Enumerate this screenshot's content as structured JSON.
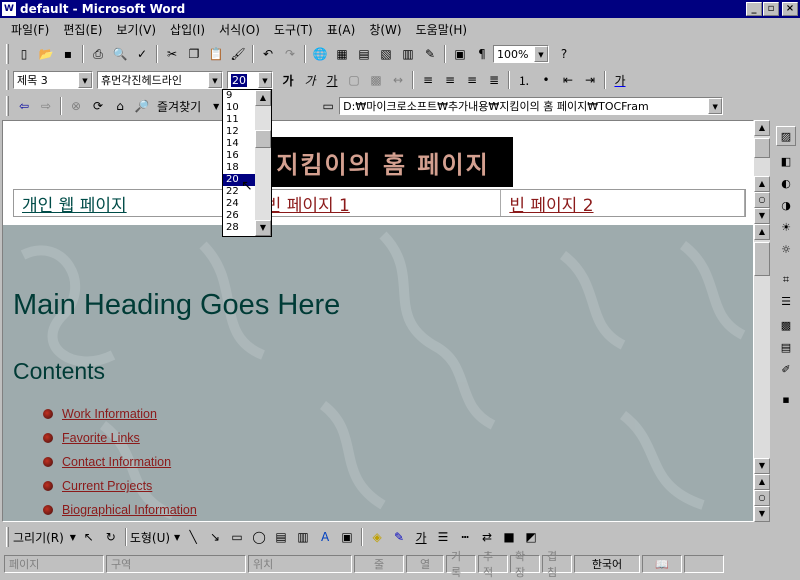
{
  "window": {
    "title": "default - Microsoft Word"
  },
  "menu": [
    "파일(F)",
    "편집(E)",
    "보기(V)",
    "삽입(I)",
    "서식(O)",
    "도구(T)",
    "표(A)",
    "창(W)",
    "도움말(H)"
  ],
  "toolbar": {
    "zoom": "100%"
  },
  "format": {
    "style": "제목 3",
    "font": "휴먼각진헤드라인",
    "size": "20"
  },
  "web": {
    "favorites": "즐겨찾기",
    "address": "D:₩마이크로소프트₩추가내용₩지킴이의 홈 페이지₩TOCFram"
  },
  "fontsizes": [
    "9",
    "10",
    "11",
    "12",
    "14",
    "16",
    "18",
    "20",
    "22",
    "24",
    "26",
    "28"
  ],
  "document": {
    "banner": "지킴이의 홈 페이지",
    "nav": [
      "개인 웹 페이지",
      "빈 페이지 1",
      "빈 페이지 2"
    ],
    "heading": "Main Heading Goes Here",
    "contents": "Contents",
    "links": [
      "Work Information",
      "Favorite Links",
      "Contact Information",
      "Current Projects",
      "Biographical Information"
    ]
  },
  "drawing": {
    "draw": "그리기(R)",
    "autoshapes": "도형(U)"
  },
  "statusbar": [
    "페이지",
    "구역",
    "위치",
    "줄",
    "열",
    "기록",
    "추적",
    "확장",
    "겹침",
    "한국어"
  ]
}
